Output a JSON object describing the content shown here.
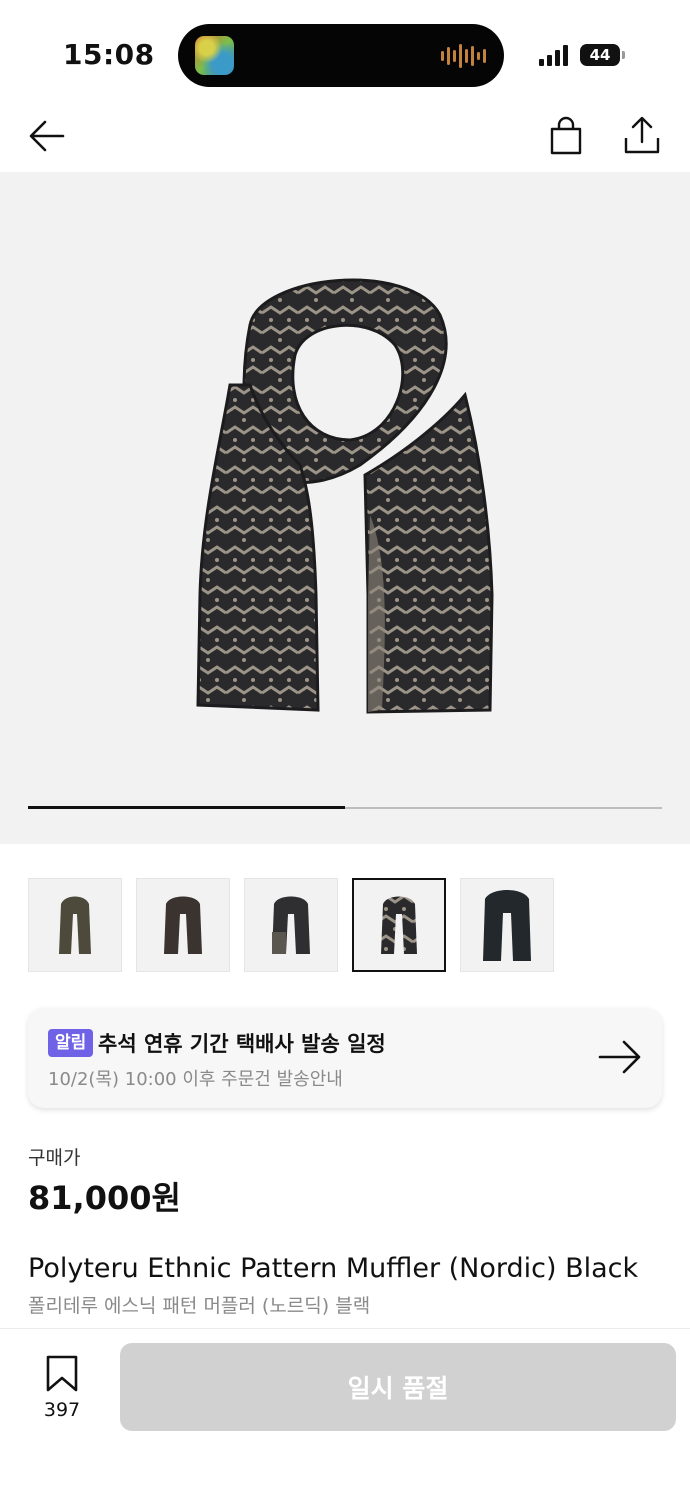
{
  "status_bar": {
    "time": "15:08",
    "battery": "44"
  },
  "nav": {
    "back_icon": "arrow-left-icon",
    "bag_icon": "shopping-bag-icon",
    "share_icon": "share-icon"
  },
  "gallery": {
    "image_icon": "scarf-image",
    "progress_fraction": 0.5,
    "thumbnail_count": 5,
    "active_thumbnail": 4
  },
  "notice": {
    "badge": "알림",
    "title": "추석 연휴 기간 택배사 발송 일정",
    "subtitle": "10/2(목) 10:00 이후 주문건 발송안내"
  },
  "product": {
    "price_label": "구매가",
    "price": "81,000원",
    "name_en": "Polyteru Ethnic Pattern Muffler (Nordic) Black",
    "name_ko": "폴리테루 에스닉 패턴 머플러 (노르딕) 블랙"
  },
  "bottom_bar": {
    "bookmark_count": "397",
    "button_label": "일시 품절"
  },
  "colors": {
    "accent": "#6f62e6",
    "disabled_button": "#d1d1d1"
  }
}
